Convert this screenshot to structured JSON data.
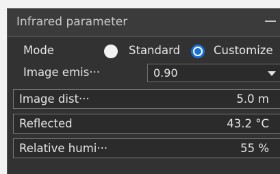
{
  "panel": {
    "title": "Infrared parameter",
    "minimize_icon": "minus-icon"
  },
  "mode": {
    "label": "Mode",
    "options": [
      {
        "label": "Standard",
        "selected": false
      },
      {
        "label": "Customize",
        "selected": true
      }
    ],
    "accent_color": "#1971d8"
  },
  "emissivity": {
    "label": "Image emis···",
    "value": "0.90"
  },
  "fields": [
    {
      "label": "Image dist···",
      "value": "5.0 m"
    },
    {
      "label": "Reflected",
      "value": "43.2 °C"
    },
    {
      "label": "Relative humi···",
      "value": "55 %"
    }
  ]
}
